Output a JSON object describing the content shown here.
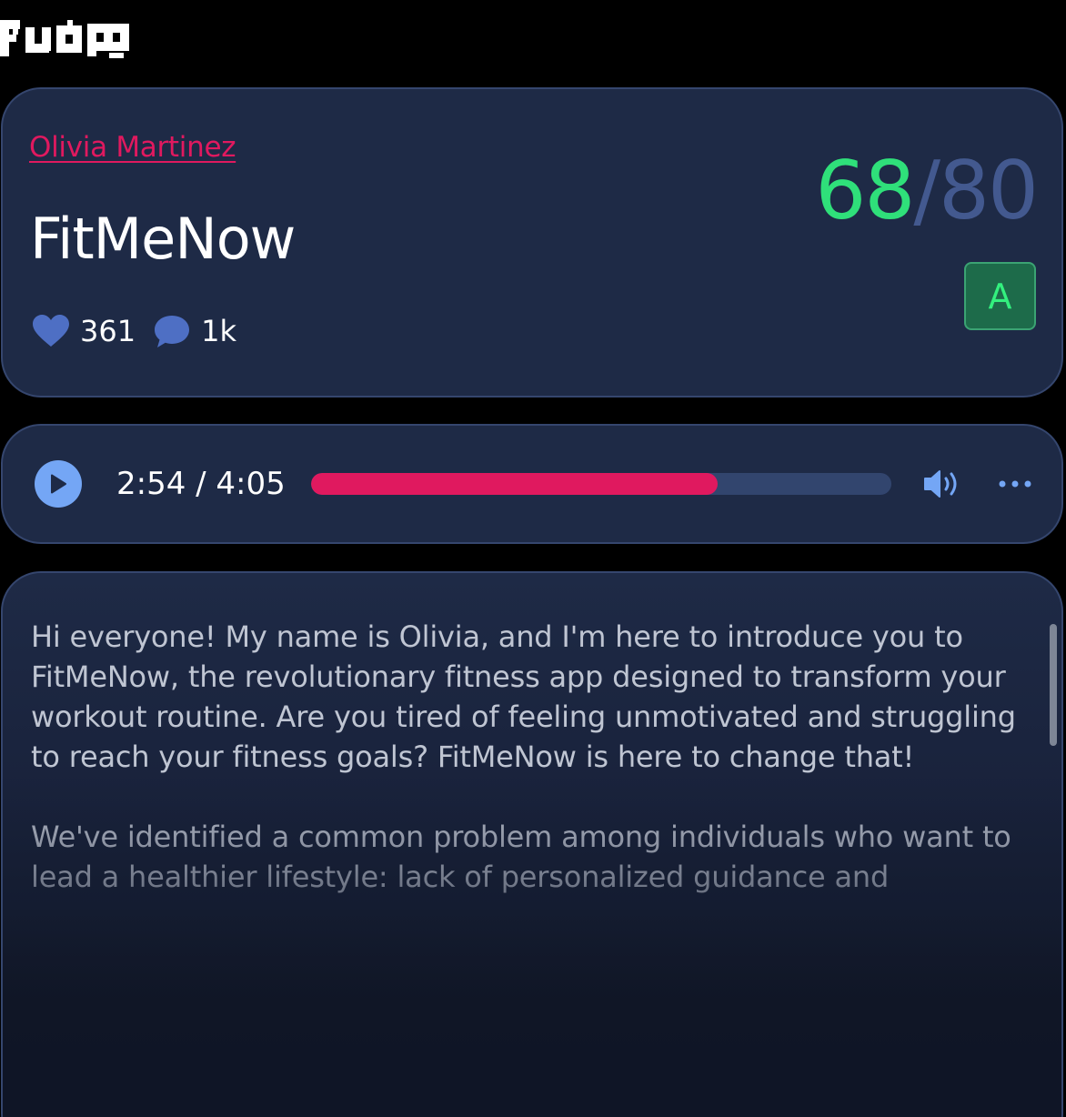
{
  "logo": {
    "label": "FLUTTERFLOW"
  },
  "info_card": {
    "author": "Olivia Martinez",
    "app_title": "FitMeNow",
    "likes": "361",
    "comments": "1k",
    "score": {
      "value": "68",
      "separator": "/",
      "max": "80"
    },
    "grade": "A"
  },
  "player": {
    "time": "2:54 / 4:05",
    "progress": 0.7
  },
  "description": {
    "paragraphs": [
      "Hi everyone! My name is Olivia, and I'm here to introduce you to FitMeNow, the revolutionary fitness app designed to transform your workout routine. Are you tired of feeling unmotivated and struggling to reach your fitness goals? FitMeNow is here to change that!",
      "We've identified a common problem among individuals who want to lead a healthier lifestyle: lack of personalized guidance and"
    ]
  },
  "colors": {
    "background": "#000000",
    "card": "#1e2a46",
    "card_border": "#35466e",
    "accent_pink": "#e0195f",
    "score_green": "#2fe07a",
    "muted_blue": "#43598f",
    "play_blue": "#74a6f5",
    "grade_bg": "#1d6b4a"
  },
  "icons": {
    "like": "heart-icon",
    "comment": "speech-bubble-icon",
    "play": "play-icon",
    "volume": "speaker-volume-icon",
    "more": "ellipsis-icon"
  }
}
